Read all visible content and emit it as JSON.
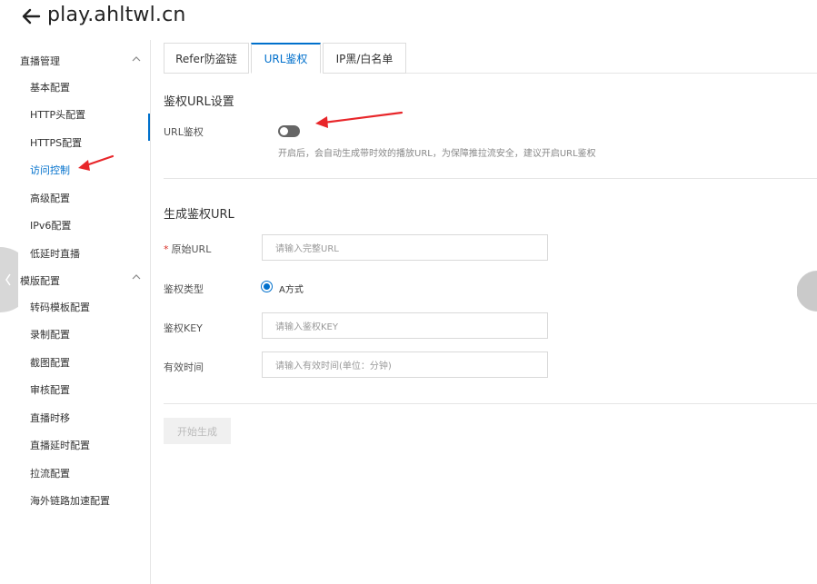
{
  "header": {
    "title": "play.ahltwl.cn"
  },
  "sidebar": {
    "groups": [
      {
        "label": "直播管理"
      },
      {
        "label": "模版配置"
      }
    ],
    "items": [
      {
        "label": "基本配置"
      },
      {
        "label": "HTTP头配置"
      },
      {
        "label": "HTTPS配置"
      },
      {
        "label": "访问控制"
      },
      {
        "label": "高级配置"
      },
      {
        "label": "IPv6配置"
      },
      {
        "label": "低延时直播"
      },
      {
        "label": "转码模板配置"
      },
      {
        "label": "录制配置"
      },
      {
        "label": "截图配置"
      },
      {
        "label": "审核配置"
      },
      {
        "label": "直播时移"
      },
      {
        "label": "直播延时配置"
      },
      {
        "label": "拉流配置"
      },
      {
        "label": "海外链路加速配置"
      }
    ]
  },
  "tabs": [
    {
      "label": "Refer防盗链"
    },
    {
      "label": "URL鉴权"
    },
    {
      "label": "IP黑/白名单"
    }
  ],
  "auth_settings": {
    "title": "鉴权URL设置",
    "switch_label": "URL鉴权",
    "switch_on": false,
    "hint": "开启后，会自动生成带时效的播放URL，为保障推拉流安全，建议开启URL鉴权"
  },
  "generate": {
    "title": "生成鉴权URL",
    "required_mark": "*",
    "original_url_label": "原始URL",
    "original_url_placeholder": "请输入完整URL",
    "auth_type_label": "鉴权类型",
    "auth_type_option": "A方式",
    "auth_key_label": "鉴权KEY",
    "auth_key_placeholder": "请输入鉴权KEY",
    "valid_time_label": "有效时间",
    "valid_time_placeholder": "请输入有效时间(单位：分钟)",
    "button_label": "开始生成"
  },
  "colors": {
    "accent": "#0070cc",
    "annotation_arrow": "#e8262a",
    "switch_off": "#666666",
    "disabled_button_bg": "#f0f0f0"
  }
}
